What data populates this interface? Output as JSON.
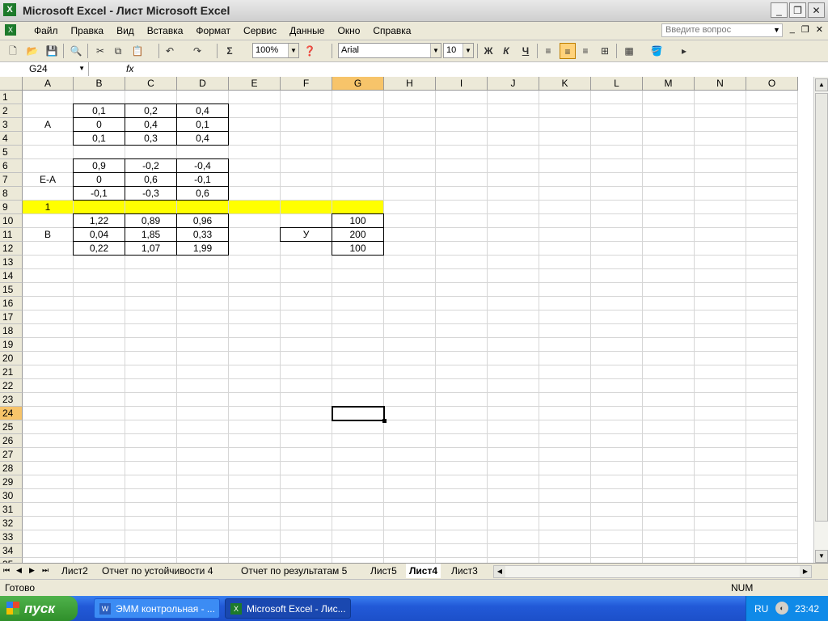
{
  "window": {
    "title": "Microsoft Excel - Лист Microsoft Excel"
  },
  "menu": {
    "items": [
      "Файл",
      "Правка",
      "Вид",
      "Вставка",
      "Формат",
      "Сервис",
      "Данные",
      "Окно",
      "Справка"
    ],
    "help_placeholder": "Введите вопрос"
  },
  "toolbar": {
    "zoom": "100%",
    "font": "Arial",
    "font_size": "10",
    "bold": "Ж",
    "italic": "К",
    "underline": "Ч",
    "sum": "Σ"
  },
  "formula_bar": {
    "name_box": "G24",
    "fx": "fx",
    "formula": ""
  },
  "grid": {
    "columns": [
      "A",
      "B",
      "C",
      "D",
      "E",
      "F",
      "G",
      "H",
      "I",
      "J",
      "K",
      "L",
      "M",
      "N",
      "O"
    ],
    "rows": [
      "1",
      "2",
      "3",
      "4",
      "5",
      "6",
      "7",
      "8",
      "9",
      "10",
      "11",
      "12",
      "13",
      "14",
      "15",
      "16",
      "17",
      "18",
      "19",
      "20",
      "21",
      "22",
      "23",
      "24",
      "25",
      "26",
      "27",
      "28",
      "29",
      "30",
      "31",
      "32",
      "33",
      "34",
      "35"
    ],
    "active_col": "G",
    "active_row": "24",
    "cells": {
      "B2": "0,1",
      "C2": "0,2",
      "D2": "0,4",
      "A3": "A",
      "B3": "0",
      "C3": "0,4",
      "D3": "0,1",
      "B4": "0,1",
      "C4": "0,3",
      "D4": "0,4",
      "B6": "0,9",
      "C6": "-0,2",
      "D6": "-0,4",
      "A7": "E-A",
      "B7": "0",
      "C7": "0,6",
      "D7": "-0,1",
      "B8": "-0,1",
      "C8": "-0,3",
      "D8": "0,6",
      "A9": "1",
      "B10": "1,22",
      "C10": "0,89",
      "D10": "0,96",
      "G10": "100",
      "A11": "B",
      "B11": "0,04",
      "C11": "1,85",
      "D11": "0,33",
      "F11": "У",
      "G11": "200",
      "B12": "0,22",
      "C12": "1,07",
      "D12": "1,99",
      "G12": "100"
    },
    "highlight_color": "#ffff00"
  },
  "sheet_tabs": [
    "Лист2",
    "Отчет по устойчивости 4",
    "Отчет по результатам 5",
    "Лист5",
    "Лист4",
    "Лист3"
  ],
  "active_tab": "Лист4",
  "status": {
    "text": "Готово",
    "num": "NUM"
  },
  "taskbar": {
    "start": "пуск",
    "tasks": [
      "ЭММ контрольная - ...",
      "Microsoft Excel - Лис..."
    ],
    "lang": "RU",
    "clock": "23:42"
  }
}
